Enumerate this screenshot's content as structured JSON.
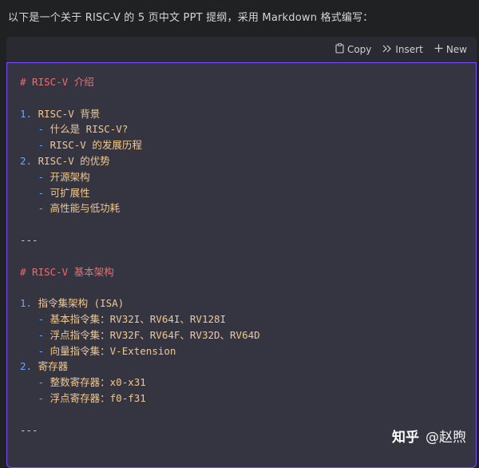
{
  "intro": "以下是一个关于 RISC-V 的 5 页中文 PPT 提纲，采用 Markdown 格式编写：",
  "toolbar": {
    "copy_label": "Copy",
    "insert_label": "Insert",
    "new_label": "New"
  },
  "code_lines": [
    {
      "type": "heading",
      "text": "# RISC-V 介绍"
    },
    {
      "type": "blank",
      "text": ""
    },
    {
      "type": "num",
      "prefix": "1. ",
      "text": "RISC-V 背景"
    },
    {
      "type": "dash",
      "prefix": "   - ",
      "text": "什么是 RISC-V?"
    },
    {
      "type": "dash",
      "prefix": "   - ",
      "text": "RISC-V 的发展历程"
    },
    {
      "type": "num",
      "prefix": "2. ",
      "text": "RISC-V 的优势"
    },
    {
      "type": "dash",
      "prefix": "   - ",
      "text": "开源架构"
    },
    {
      "type": "dash",
      "prefix": "   - ",
      "text": "可扩展性"
    },
    {
      "type": "dash",
      "prefix": "   - ",
      "text": "高性能与低功耗"
    },
    {
      "type": "blank",
      "text": ""
    },
    {
      "type": "hr",
      "text": "---"
    },
    {
      "type": "blank",
      "text": ""
    },
    {
      "type": "heading",
      "text": "# RISC-V 基本架构"
    },
    {
      "type": "blank",
      "text": ""
    },
    {
      "type": "num",
      "prefix": "1. ",
      "text": "指令集架构 (ISA)"
    },
    {
      "type": "dash",
      "prefix": "   - ",
      "text": "基本指令集：RV32I、RV64I、RV128I"
    },
    {
      "type": "dash",
      "prefix": "   - ",
      "text": "浮点指令集：RV32F、RV64F、RV32D、RV64D"
    },
    {
      "type": "dash",
      "prefix": "   - ",
      "text": "向量指令集：V-Extension"
    },
    {
      "type": "num",
      "prefix": "2. ",
      "text": "寄存器"
    },
    {
      "type": "dash",
      "prefix": "   - ",
      "text": "整数寄存器：x0-x31"
    },
    {
      "type": "dash",
      "prefix": "   - ",
      "text": "浮点寄存器：f0-f31"
    },
    {
      "type": "blank",
      "text": ""
    },
    {
      "type": "hr",
      "text": "---"
    }
  ],
  "watermark": {
    "logo": "知乎",
    "author": "@赵煦"
  }
}
